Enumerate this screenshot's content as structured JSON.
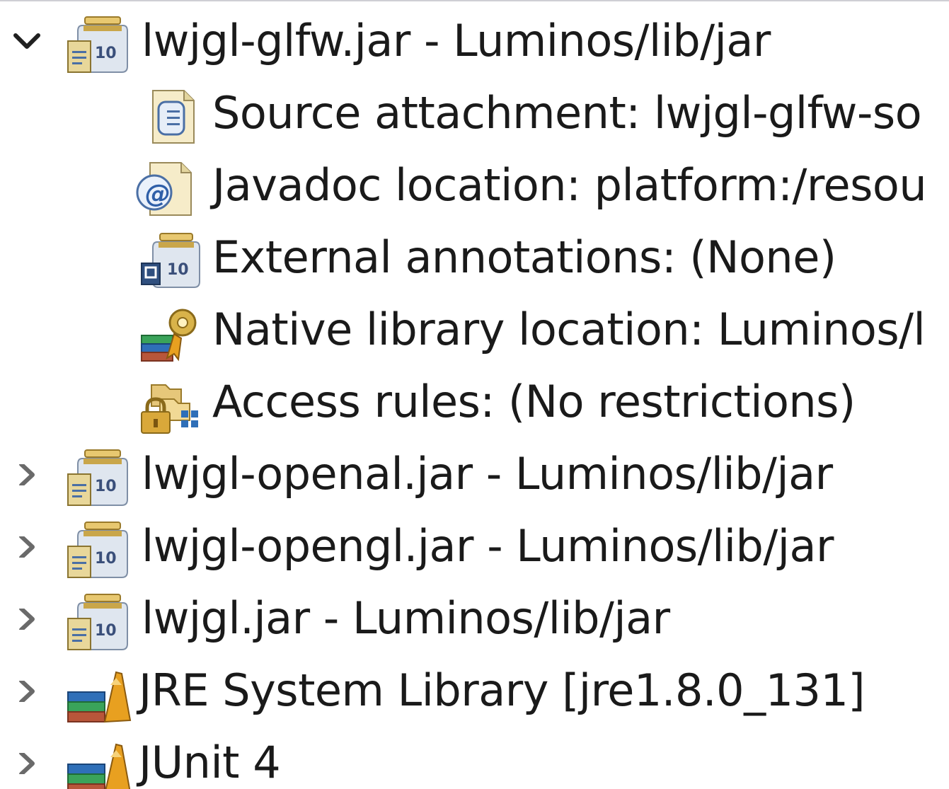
{
  "tree": {
    "items": [
      {
        "label": "lwjgl-glfw.jar - Luminos/lib/jar",
        "icon": "jar-icon",
        "expanded": true
      },
      {
        "label": "Source attachment: lwjgl-glfw-so",
        "icon": "source-attachment-icon"
      },
      {
        "label": "Javadoc location: platform:/resou",
        "icon": "javadoc-icon"
      },
      {
        "label": "External annotations: (None)",
        "icon": "external-annotations-icon"
      },
      {
        "label": "Native library location: Luminos/l",
        "icon": "native-library-icon"
      },
      {
        "label": "Access rules: (No restrictions)",
        "icon": "access-rules-icon"
      },
      {
        "label": "lwjgl-openal.jar - Luminos/lib/jar",
        "icon": "jar-icon",
        "expanded": false
      },
      {
        "label": "lwjgl-opengl.jar - Luminos/lib/jar",
        "icon": "jar-icon",
        "expanded": false
      },
      {
        "label": "lwjgl.jar - Luminos/lib/jar",
        "icon": "jar-icon",
        "expanded": false
      },
      {
        "label": "JRE System Library [jre1.8.0_131]",
        "icon": "library-icon",
        "expanded": false
      },
      {
        "label": "JUnit 4",
        "icon": "library-icon",
        "expanded": false
      }
    ]
  }
}
